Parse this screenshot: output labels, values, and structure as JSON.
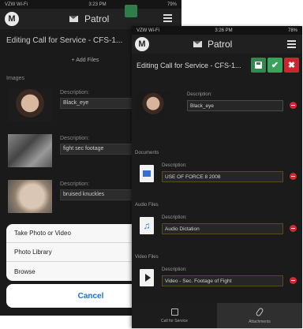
{
  "back_phone": {
    "status": {
      "carrier": "VZW Wi-Fi",
      "time": "3:23 PM",
      "battery": "79%"
    },
    "header": {
      "logo": "M",
      "title": "Patrol"
    },
    "edit_title": "Editing Call for Service - CFS-1...",
    "add_files_label": "+ Add Files",
    "images_label": "Images",
    "desc_label": "Description:",
    "images": [
      {
        "description": "Black_eye"
      },
      {
        "description": "fight sec footage"
      },
      {
        "description": "bruised knuckles"
      }
    ],
    "action_sheet": {
      "options": [
        "Take Photo or Video",
        "Photo Library",
        "Browse"
      ],
      "cancel": "Cancel"
    }
  },
  "front_phone": {
    "status": {
      "carrier": "VZW Wi-Fi",
      "time": "3:26 PM",
      "battery": "78%"
    },
    "header": {
      "logo": "M",
      "title": "Patrol"
    },
    "edit_title": "Editing Call for Service - CFS-1...",
    "desc_label": "Description:",
    "image_item": {
      "description": "Black_eye"
    },
    "sections": {
      "documents": "Documents",
      "audio": "Audio Files",
      "video": "Video Files"
    },
    "document_item": {
      "description": "USE OF FORCE 8 2008"
    },
    "audio_item": {
      "description": "Audio Dictation"
    },
    "video_item": {
      "description": "Video - Sec. Footage of Fight"
    },
    "tabs": [
      {
        "label": "Call for Service",
        "icon": "edit-icon"
      },
      {
        "label": "Attachments",
        "icon": "paperclip-icon"
      }
    ],
    "colors": {
      "save": "#2f8a52",
      "ok": "#3aa35b",
      "cancel": "#c8282d",
      "remove": "#d02a30"
    }
  }
}
